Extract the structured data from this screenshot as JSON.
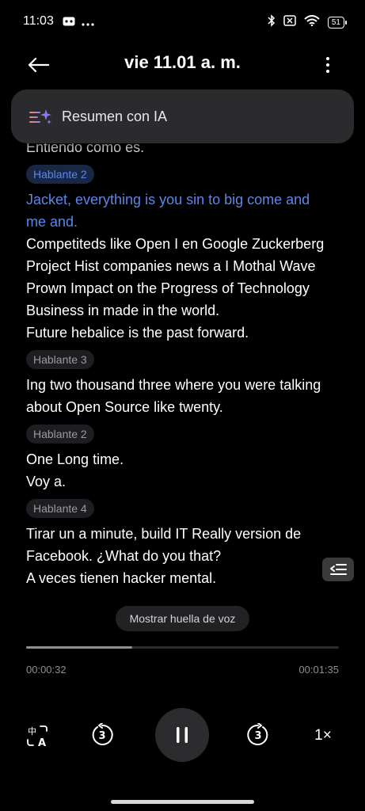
{
  "status_bar": {
    "time": "11:03",
    "battery": "51",
    "icons": [
      "message-icon",
      "more-notifications-icon",
      "bluetooth-icon",
      "sim-icon",
      "wifi-icon",
      "battery-icon"
    ]
  },
  "header": {
    "title": "vie 11.01 a. m.",
    "back_icon": "back-arrow-icon",
    "more_icon": "more-vertical-icon"
  },
  "ai_summary": {
    "label": "Resumen con IA",
    "icon": "sparkle-list-icon"
  },
  "transcript": {
    "partial_line": "Entiendo cómo es.",
    "blocks": [
      {
        "speaker": "Hablante 2",
        "active": true,
        "lines": [
          "Jacket, everything is you sin to big come and",
          "me and."
        ]
      },
      {
        "speaker": "",
        "active": false,
        "lines": [
          "Competiteds like Open I en Google Zuckerberg",
          "Project Hist companies news a I Mothal Wave",
          "Prown Impact on the Progress of Technology",
          "Business in made in the world.",
          "Future hebalice is the past forward."
        ]
      },
      {
        "speaker": "Hablante 3",
        "active": false,
        "lines": [
          "Ing two thousand three where you were talking",
          "about Open Source like twenty."
        ]
      },
      {
        "speaker": "Hablante 2",
        "active": false,
        "lines": [
          "One Long time.",
          "Voy a."
        ]
      },
      {
        "speaker": "Hablante 4",
        "active": false,
        "lines": [
          "Tirar un a minute, build IT Really version de",
          "Facebook. ¿What do you that?",
          "A veces tienen hacker mental."
        ]
      }
    ]
  },
  "voice_print": {
    "label": "Mostrar huella de voz"
  },
  "player": {
    "elapsed": "00:00:32",
    "total": "00:01:35",
    "progress": 0.34,
    "speed": "1×",
    "rewind_seconds": "3",
    "forward_seconds": "3"
  },
  "colors": {
    "background": "#000000",
    "accent": "#5b86ea",
    "banner": "#2b2b2d",
    "muted": "#8e8e93"
  }
}
